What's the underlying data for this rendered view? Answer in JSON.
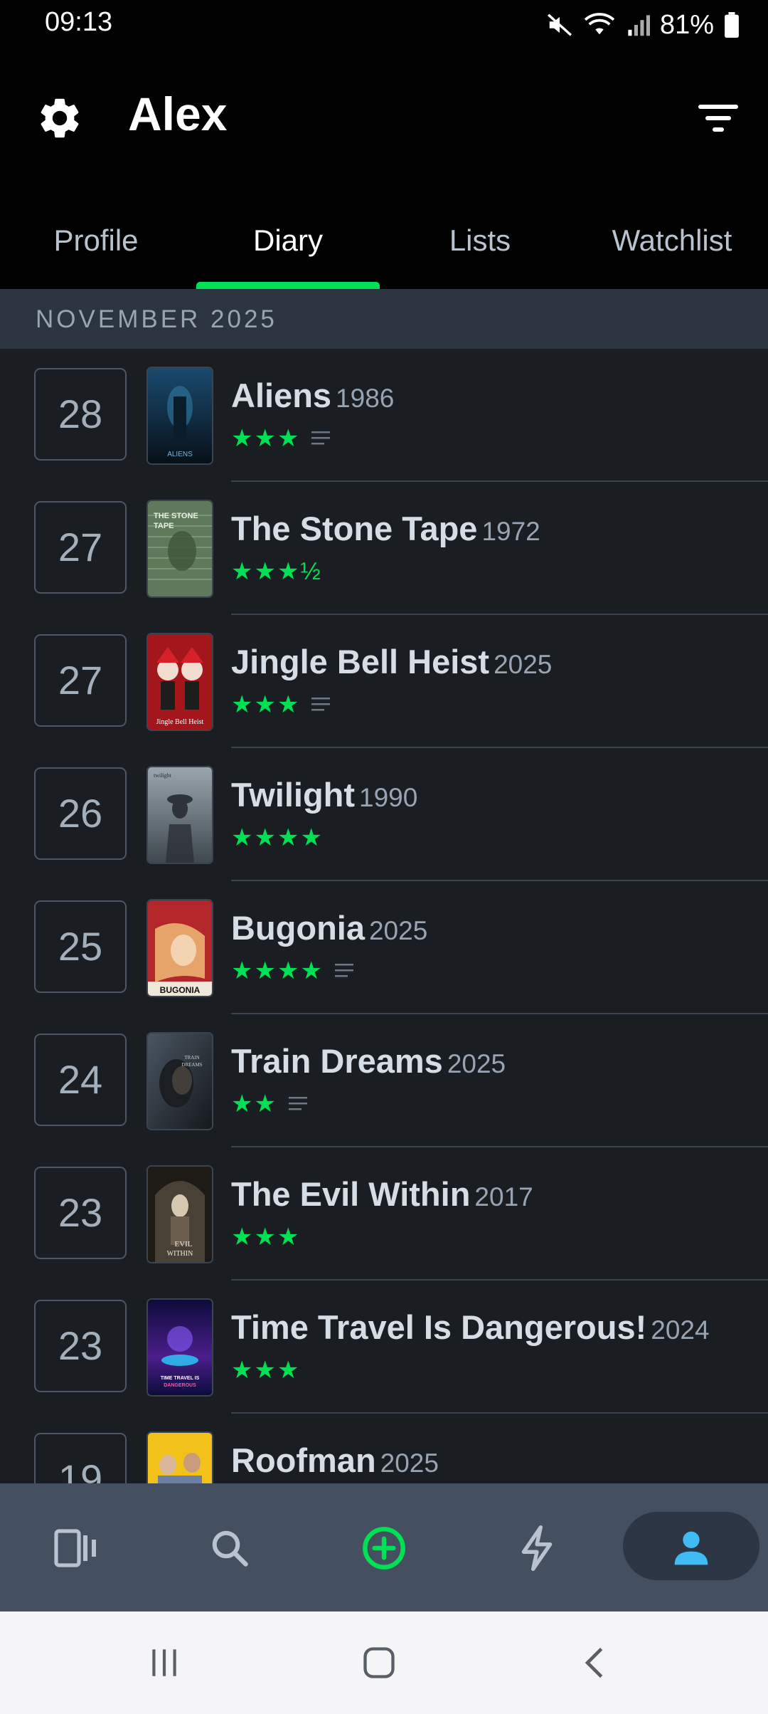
{
  "status_bar": {
    "time": "09:13",
    "battery": "81%",
    "icons": [
      "mute-icon",
      "wifi-icon",
      "signal-icon",
      "battery-icon"
    ]
  },
  "header": {
    "title": "Alex",
    "settings_icon": "gear-icon",
    "filter_icon": "filter-icon"
  },
  "tabs": [
    {
      "label": "Profile",
      "active": false
    },
    {
      "label": "Diary",
      "active": true
    },
    {
      "label": "Lists",
      "active": false
    },
    {
      "label": "Watchlist",
      "active": false
    }
  ],
  "month": "NOVEMBER 2025",
  "entries": [
    {
      "day": "28",
      "title": "Aliens",
      "year": "1986",
      "stars": "★★★",
      "review": true
    },
    {
      "day": "27",
      "title": "The Stone Tape",
      "year": "1972",
      "stars": "★★★½",
      "review": false
    },
    {
      "day": "27",
      "title": "Jingle Bell Heist",
      "year": "2025",
      "stars": "★★★",
      "review": true
    },
    {
      "day": "26",
      "title": "Twilight",
      "year": "1990",
      "stars": "★★★★",
      "review": false
    },
    {
      "day": "25",
      "title": "Bugonia",
      "year": "2025",
      "stars": "★★★★",
      "review": true
    },
    {
      "day": "24",
      "title": "Train Dreams",
      "year": "2025",
      "stars": "★★",
      "review": true
    },
    {
      "day": "23",
      "title": "The Evil Within",
      "year": "2017",
      "stars": "★★★",
      "review": false
    },
    {
      "day": "23",
      "title": "Time Travel Is Dangerous!",
      "year": "2024",
      "stars": "★★★",
      "review": false
    },
    {
      "day": "19",
      "title": "Roofman",
      "year": "2025",
      "stars": "",
      "review": false
    }
  ],
  "colors": {
    "accent_green": "#00e054",
    "active_blue": "#40bcf4",
    "background": "#1a1d22"
  },
  "bottom_nav": [
    {
      "icon": "films-icon",
      "active": false
    },
    {
      "icon": "search-icon",
      "active": false
    },
    {
      "icon": "add-icon",
      "active": false
    },
    {
      "icon": "activity-icon",
      "active": false
    },
    {
      "icon": "profile-icon",
      "active": true
    }
  ],
  "system_nav": [
    "recent-apps-icon",
    "home-icon",
    "back-icon"
  ]
}
